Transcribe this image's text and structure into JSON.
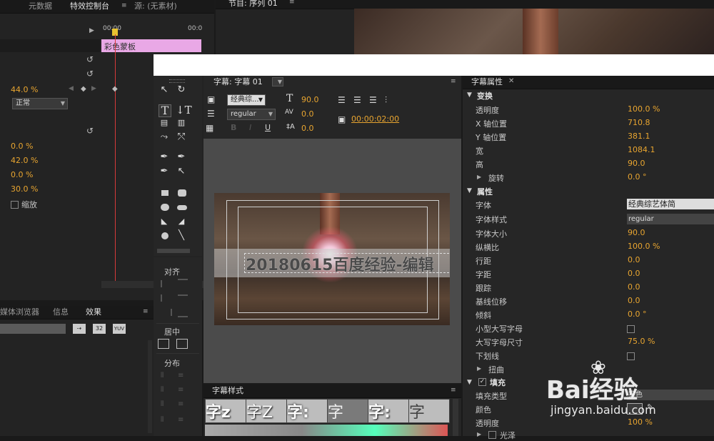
{
  "effect_controls": {
    "tabs": [
      "元数据",
      "特效控制台",
      "源: (无素材)"
    ],
    "timecode_left": "00:00",
    "timecode_right": "00:0",
    "clip_name": "彩色蒙板",
    "values": [
      "44.0 %",
      "正常",
      "0.0 %",
      "42.0 %",
      "0.0 %",
      "30.0 %"
    ],
    "scale_label": "缩放"
  },
  "program": {
    "tab": "节目: 序列 01"
  },
  "effects_panel": {
    "tabs": [
      "媒体浏览器",
      "信息",
      "效果"
    ],
    "btn_32": "32",
    "btn_yuv": "YUV"
  },
  "titler": {
    "tab": "字幕: 字幕 01",
    "font_family": "经典综...",
    "font_style": "regular",
    "font_size": "90.0",
    "tracking": "0.0",
    "leading": "0.0",
    "timecode": "00:00:02:00",
    "title_text": "20180615百度经验-编辑"
  },
  "tools_panel": {
    "align_label": "对齐",
    "center_label": "居中",
    "distribute_label": "分布"
  },
  "styles_panel": {
    "tab": "字幕样式",
    "swatches": [
      "字z",
      "字Z",
      "字:",
      "字",
      "字:",
      "字"
    ]
  },
  "properties": {
    "tab": "字幕属性",
    "transform_header": "变换",
    "opacity_label": "透明度",
    "opacity": "100.0 %",
    "x_label": "X 轴位置",
    "x": "710.8",
    "y_label": "Y 轴位置",
    "y": "381.1",
    "width_label": "宽",
    "width": "1084.1",
    "height_label": "高",
    "height": "90.0",
    "rotation_label": "旋转",
    "rotation": "0.0 °",
    "attrs_header": "属性",
    "font_label": "字体",
    "font": "经典综艺体简",
    "font_style_label": "字体样式",
    "font_style": "regular",
    "font_size_label": "字体大小",
    "font_size": "90.0",
    "aspect_label": "纵横比",
    "aspect": "100.0 %",
    "leading_label": "行距",
    "leading": "0.0",
    "kerning_label": "字距",
    "kerning": "0.0",
    "tracking_label": "跟踪",
    "tracking": "0.0",
    "baseline_label": "基线位移",
    "baseline": "0.0",
    "slant_label": "倾斜",
    "slant": "0.0 °",
    "smallcaps_label": "小型大写字母",
    "smallcaps_size_label": "大写字母尺寸",
    "smallcaps_size": "75.0 %",
    "underline_label": "下划线",
    "distort_label": "扭曲",
    "fill_header": "填充",
    "fill_type_label": "填充类型",
    "fill_type": "实色",
    "color_label": "颜色",
    "fill_opacity_label": "透明度",
    "fill_opacity": "100 %",
    "sheen_label": "光泽"
  },
  "watermark": {
    "logo": "Bai经验",
    "url": "jingyan.baidu.com"
  },
  "colors": {
    "accent_orange": "#e8a530",
    "clip_pink": "#e9a8e6",
    "playhead_red": "#d63a3a"
  }
}
